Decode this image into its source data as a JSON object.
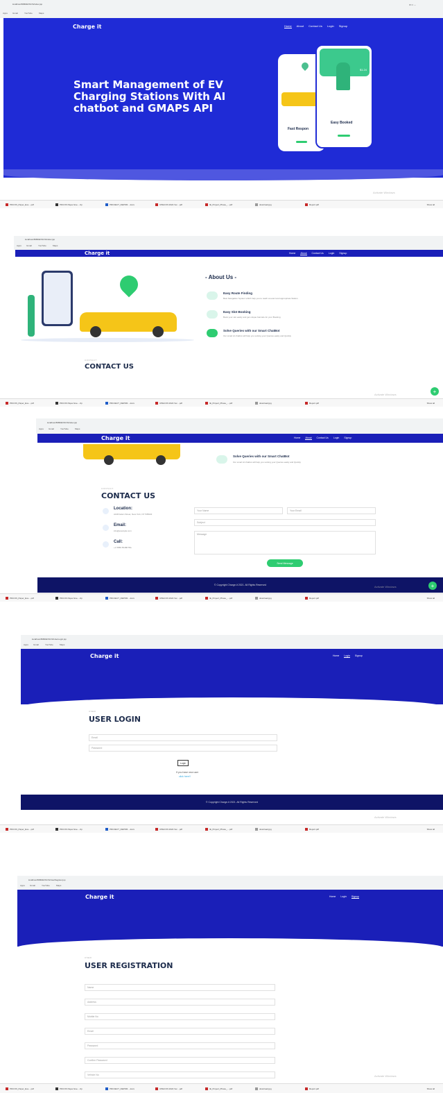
{
  "browser": {
    "url_home": "localhost:8080/EVNCS/index.jsp",
    "url_about": "localhost:8080/EVNCS/index.jsp",
    "url_login": "localhost:8080/EVNCS/UserLogin.jsp",
    "url_register": "localhost:8080/EVNCS/UserRegister.jsp",
    "bookmarks": [
      "Apps",
      "Gmail",
      "YouTube",
      "Maps"
    ]
  },
  "nav": {
    "brand": "Charge it",
    "links_full": [
      "Home",
      "About",
      "Contact Us",
      "Login",
      "Signup"
    ],
    "links_login": [
      "Home",
      "Login",
      "Signup"
    ]
  },
  "hero": {
    "title": "Smart Management of EV Charging Stations With AI chatbot and GMAPS API",
    "card_left": "Fast Respon",
    "card_right": "Easy Booked",
    "price_tag": "$1.24"
  },
  "about": {
    "heading": "- About Us -",
    "features": [
      {
        "title": "Easy Route Finding",
        "desc": "Best Navigation System which help you to reach at exact and appropriate Station"
      },
      {
        "title": "Easy Slot Booking",
        "desc": "Book your slot easily and get unique barcode for your Booking"
      },
      {
        "title": "Solve Queries with our Smart ChatBot",
        "desc": "Our smart AI chatbot will help you solving your Queries easily and Quickly"
      }
    ]
  },
  "contact": {
    "label": "CONTACT",
    "title": "CONTACT US",
    "location_label": "Location:",
    "location_value": "A108 Adam Street, New York, NY 535022",
    "email_label": "Email:",
    "email_value": "info@example.com",
    "call_label": "Call:",
    "call_value": "+1 5589 55488 55s",
    "name_placeholder": "Your Name",
    "email_placeholder": "Your Email",
    "subject_placeholder": "Subject",
    "message_placeholder": "Message",
    "send_button": "Send Message"
  },
  "footer": {
    "text": "© Copyright Charge-it 2021. All Rights Reserved"
  },
  "login": {
    "label": "USER",
    "title": "USER LOGIN",
    "email_placeholder": "Email",
    "password_placeholder": "Password",
    "button": "Login",
    "new_user_text": "If you have new user",
    "click_here": "click here!!"
  },
  "register": {
    "label": "USER",
    "title": "USER REGISTRATION",
    "fields": [
      "Name",
      "Address",
      "Mobile No",
      "Email",
      "Password",
      "Confirm Password",
      "Vehicle No"
    ]
  },
  "downloads": {
    "items": [
      "PDCON_Paper_Eve....pdf",
      "PDCON Paper Eve....zip",
      "PROJECT_REPOR....docx",
      "CPECON 2022 Ver....pdf",
      "IE_Project_Phase_....pdf",
      "download.jpg",
      "Report.pdf"
    ],
    "show_all": "Show all"
  },
  "windows": {
    "activate": "Activate Windows",
    "activate_sub": "Go to Settings to activate Windows."
  }
}
